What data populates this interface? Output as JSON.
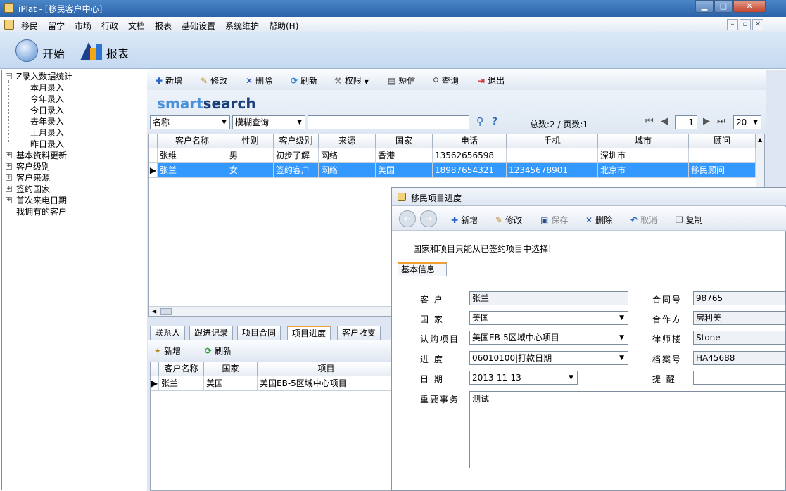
{
  "window": {
    "title": "iPlat - [移民客户中心]"
  },
  "menu": [
    "移民",
    "留学",
    "市场",
    "行政",
    "文档",
    "报表",
    "基础设置",
    "系统维护",
    "帮助(H)"
  ],
  "bigbar": {
    "start": "开始",
    "report": "报表"
  },
  "tree": {
    "root": "Z录入数据统计",
    "children": [
      "本月录入",
      "今年录入",
      "今日录入",
      "去年录入",
      "上月录入",
      "昨日录入"
    ],
    "groups": [
      "基本资料更新",
      "客户级别",
      "客户来源",
      "签约国家",
      "首次来电日期"
    ],
    "leaf": "我拥有的客户"
  },
  "toolbar": {
    "add": "新增",
    "edit": "修改",
    "delete": "删除",
    "refresh": "刷新",
    "permission": "权限",
    "sms": "短信",
    "query": "查询",
    "exit": "退出"
  },
  "search": {
    "logo_smart": "smart",
    "logo_search": "search",
    "field": "名称",
    "mode": "模糊查询",
    "keyword": "",
    "summary": "总数:2 / 页数:1",
    "page": "1",
    "page_size": "20"
  },
  "grid": {
    "columns": [
      "客户名称",
      "性别",
      "客户级别",
      "来源",
      "国家",
      "电话",
      "手机",
      "城市",
      "顾问"
    ],
    "rows": [
      [
        "张维",
        "男",
        "初步了解",
        "网络",
        "香港",
        "13562656598",
        "",
        "深圳市",
        ""
      ],
      [
        "张兰",
        "女",
        "签约客户",
        "网络",
        "美国",
        "18987654321",
        "12345678901",
        "北京市",
        "移民顾问"
      ]
    ]
  },
  "bottom_tabs": [
    "联系人",
    "跟进记录",
    "项目合同",
    "项目进度",
    "客户收支"
  ],
  "bottom_toolbar": {
    "add": "新增",
    "refresh": "刷新"
  },
  "grid2": {
    "columns": [
      "客户名称",
      "国家",
      "项目"
    ],
    "rows": [
      [
        "张兰",
        "美国",
        "美国EB-5区域中心项目"
      ]
    ]
  },
  "dialog": {
    "title": "移民项目进度",
    "toolbar": {
      "add": "新增",
      "edit": "修改",
      "save": "保存",
      "delete": "删除",
      "cancel": "取消",
      "copy": "复制"
    },
    "notice": "国家和项目只能从已签约项目中选择!",
    "tab": "基本信息",
    "labels": {
      "customer": "客 户",
      "country": "国 家",
      "project": "认购项目",
      "progress": "进 度",
      "date": "日 期",
      "important": "重要事务",
      "contract_no": "合同号",
      "partner": "合作方",
      "law_firm": "律师楼",
      "file_no": "档案号",
      "remind": "提 醒"
    },
    "values": {
      "customer": "张兰",
      "country": "美国",
      "project": "美国EB-5区域中心项目",
      "progress": "06010100|打款日期",
      "date": "2013-11-13",
      "important": "测试",
      "contract_no": "98765",
      "partner": "房利美",
      "law_firm": "Stone",
      "file_no": "HA45688",
      "remind": ""
    }
  }
}
